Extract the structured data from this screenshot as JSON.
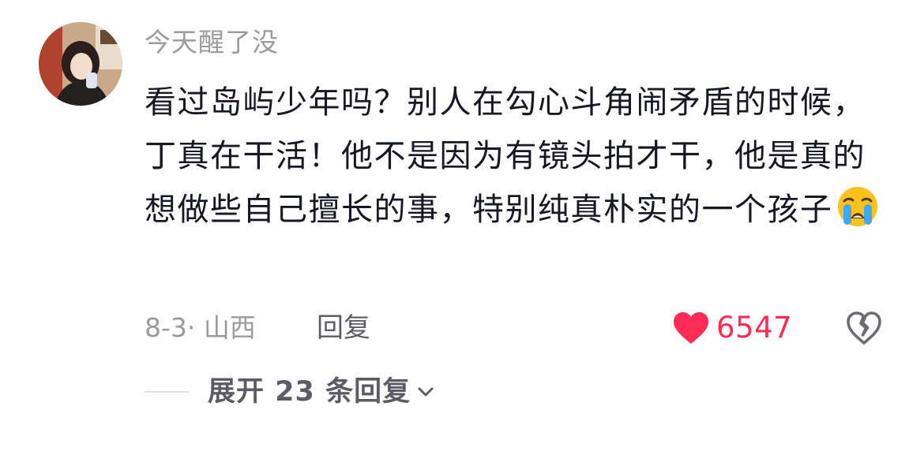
{
  "comment": {
    "username": "今天醒了没",
    "text": "看过岛屿少年吗？别人在勾心斗角闹矛盾的时候，丁真在干活！他不是因为有镜头拍才干，他是真的想做些自己擅长的事，特别纯真朴实的一个孩子",
    "emoji": "loudly-crying-face",
    "date_location": "8-3· 山西",
    "reply_label": "回复",
    "like_count": "6547",
    "liked": true,
    "expand_label": "展开 23 条回复"
  },
  "icons": {
    "avatar": "user-avatar",
    "like": "heart-icon",
    "dislike": "broken-heart-icon",
    "expand": "chevron-down-icon"
  },
  "colors": {
    "like_active": "#fe2c55",
    "text_primary": "#161823",
    "text_secondary": "#9b9b9b",
    "action_text": "#5c5c66"
  }
}
